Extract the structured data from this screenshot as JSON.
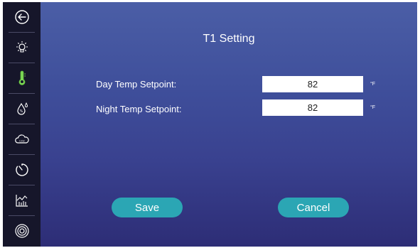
{
  "sidebar": {
    "items": [
      {
        "icon": "back-arrow-icon"
      },
      {
        "icon": "light-bulb-icon"
      },
      {
        "icon": "thermometer-icon",
        "active": true
      },
      {
        "icon": "humidity-icon"
      },
      {
        "icon": "co2-cloud-icon"
      },
      {
        "icon": "timer-icon"
      },
      {
        "icon": "chart-icon"
      },
      {
        "icon": "settings-circle-icon"
      }
    ],
    "active_color": "#7ed957"
  },
  "main": {
    "title": "T1 Setting",
    "fields": [
      {
        "label": "Day Temp Setpoint:",
        "value": "82",
        "unit": "°F"
      },
      {
        "label": "Night Temp Setpoint:",
        "value": "82",
        "unit": "°F"
      }
    ],
    "buttons": {
      "save": "Save",
      "cancel": "Cancel"
    },
    "colors": {
      "button": "#2ba6b4",
      "gradient_top": "#4b5ea6",
      "gradient_bottom": "#2d2d76"
    }
  }
}
